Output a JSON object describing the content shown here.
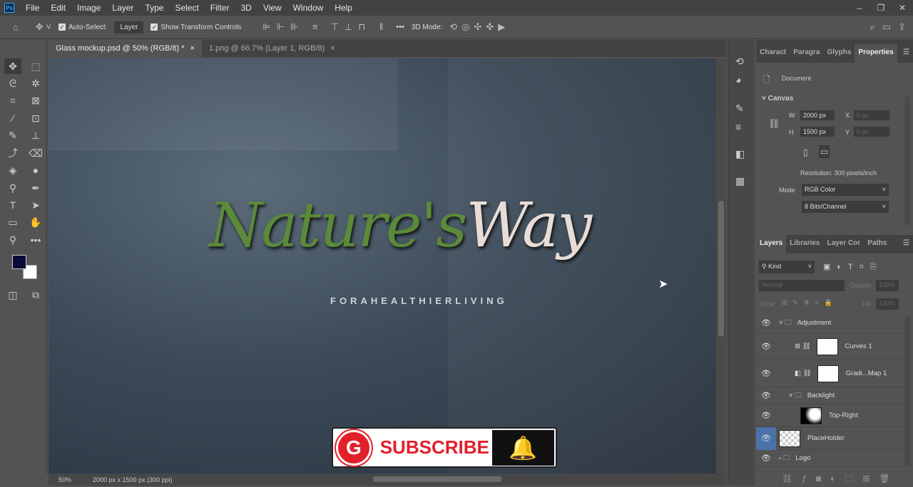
{
  "app": {
    "logo": "Ps"
  },
  "menu": [
    "File",
    "Edit",
    "Image",
    "Layer",
    "Type",
    "Select",
    "Filter",
    "3D",
    "View",
    "Window",
    "Help"
  ],
  "options": {
    "auto_select": "Auto-Select:",
    "auto_select_target": "Layer",
    "show_transform": "Show Transform Controls",
    "mode_3d": "3D Mode:",
    "more": "•••"
  },
  "tabs": [
    {
      "label": "Glass mockup.psd @ 50% (RGB/8) *",
      "active": true
    },
    {
      "label": "1.png @ 66.7% (Layer 1, RGB/8)",
      "active": false
    }
  ],
  "canvas": {
    "logo_part1": "Nature's",
    "logo_part2": "Way",
    "tagline": "FORAHEALTHIERLIVING"
  },
  "overlay": {
    "subscribe": "SUBSCRIBE",
    "icon": "G"
  },
  "status": {
    "zoom": "50%",
    "doc_info": "2000 px x 1500 px (300 ppi)"
  },
  "properties": {
    "tabs": [
      "Charact",
      "Paragra",
      "Glyphs",
      "Properties"
    ],
    "section": "Document",
    "canvas_header": "Canvas",
    "w_label": "W",
    "w": "2000 px",
    "h_label": "H",
    "h": "1500 px",
    "x_label": "X",
    "x": "0 px",
    "y_label": "Y",
    "y": "0 px",
    "resolution": "Resolution: 300 pixels/inch",
    "mode_label": "Mode",
    "mode": "RGB Color",
    "depth": "8 Bits/Channel"
  },
  "layers_panel": {
    "tabs": [
      "Layers",
      "Libraries",
      "Layer Cor",
      "Paths"
    ],
    "filter": "Kind",
    "blend": "Normal",
    "opacity_label": "Opacity:",
    "opacity": "100%",
    "lock_label": "Lock:",
    "fill_label": "Fill:",
    "fill": "100%",
    "layers": [
      {
        "name": "Adjustment",
        "type": "group"
      },
      {
        "name": "Curves 1",
        "type": "adjustment"
      },
      {
        "name": "Gradi...Map 1",
        "type": "adjustment"
      },
      {
        "name": "Backlight",
        "type": "group"
      },
      {
        "name": "Top-Right",
        "type": "layer"
      },
      {
        "name": "PlaceHolder",
        "type": "smart",
        "selected": true
      },
      {
        "name": "Logo",
        "type": "group"
      }
    ]
  }
}
